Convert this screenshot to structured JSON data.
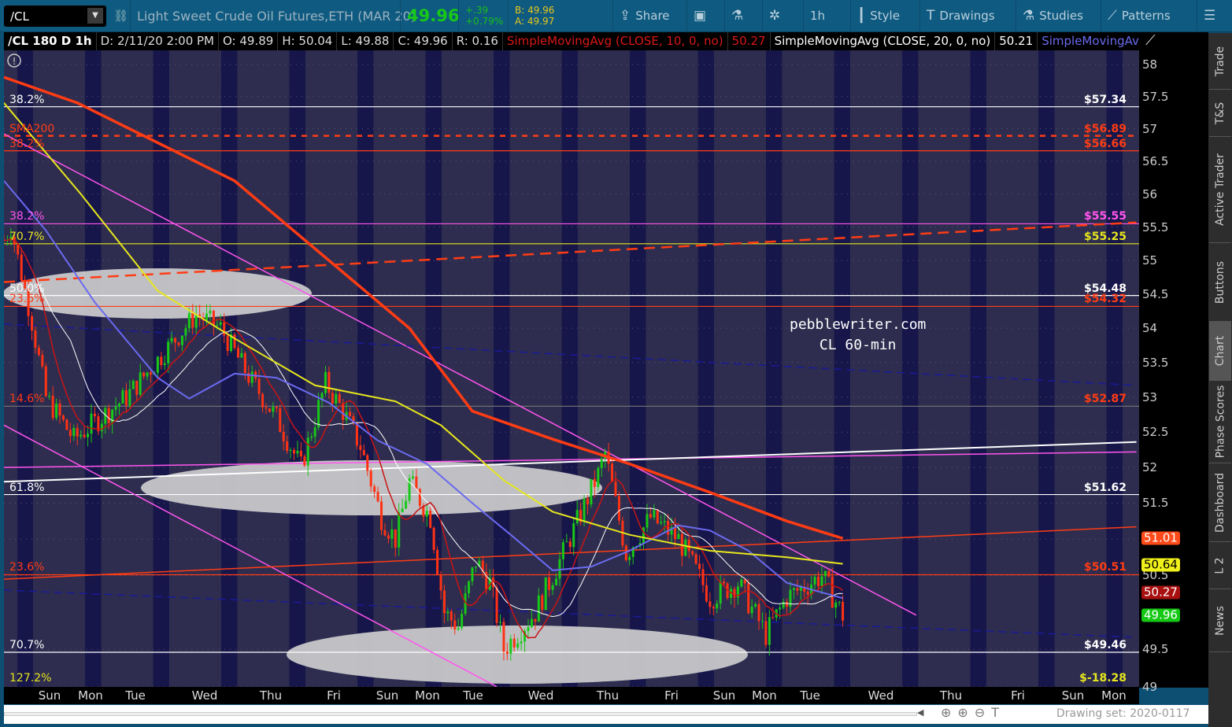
{
  "toolbar": {
    "symbol": "/CL",
    "description": "Light Sweet Crude Oil Futures,ETH (MAR 20)",
    "last": "49.96",
    "change": "+.39",
    "change_pct": "+0.79%",
    "bid": "B: 49.96",
    "ask": "A: 49.97",
    "buttons": [
      {
        "label": "Share",
        "icon": "share-icon"
      },
      {
        "label": "",
        "icon": "info-icon"
      },
      {
        "label": "",
        "icon": "flask-icon"
      },
      {
        "label": "",
        "icon": "gear-icon"
      },
      {
        "label": "1h",
        "icon": ""
      },
      {
        "label": "Style",
        "icon": "candle-icon"
      },
      {
        "label": "Drawings",
        "icon": "text-t-icon"
      },
      {
        "label": "Studies",
        "icon": "flask-icon"
      },
      {
        "label": "Patterns",
        "icon": "patterns-icon"
      },
      {
        "label": "",
        "icon": "menu-icon"
      }
    ]
  },
  "header": {
    "title": "/CL 180 D 1h",
    "date": "D: 2/11/20 2:00 PM",
    "open": "O: 49.89",
    "high": "H: 50.04",
    "low": "L: 49.88",
    "close": "C: 49.96",
    "range": "R: 0.16",
    "sma1": "SimpleMovingAvg (CLOSE, 10, 0, no)",
    "sma1_val": "50.27",
    "sma2": "SimpleMovingAvg (CLOSE, 20, 0, no)",
    "sma2_val": "50.21",
    "sma3": "SimpleMovingAvg ..."
  },
  "watermark": [
    "pebblewriter.com",
    "CL 60-min"
  ],
  "sidebar": [
    "Trade",
    "T&S",
    "Active Trader",
    "Buttons",
    "Chart",
    "Phase Scores",
    "Dashboard",
    "L 2",
    "News"
  ],
  "drawing_set": "Drawing set: 2020-0117",
  "colors": {
    "sma200": "#ff3c14",
    "sma100": "#e6e61e",
    "sma50": "#6a6af0",
    "sma10": "#c81414",
    "sma20": "#ffffff",
    "up": "#18c818",
    "down": "#ff3214",
    "bg": "#2e2d4f",
    "session": "#17164a"
  },
  "chart_data": {
    "type": "candlestick",
    "ylim": [
      48.9,
      58.4
    ],
    "scale": "log",
    "yticks": [
      "58",
      "57.5",
      "57",
      "56.5",
      "56",
      "55.5",
      "55",
      "54.5",
      "54",
      "53.5",
      "53",
      "52.5",
      "52",
      "51.5",
      "51",
      "50.5",
      "49.5",
      "49"
    ],
    "xticks": [
      "Sun",
      "Mon",
      "Tue",
      "Wed",
      "Thu",
      "Fri",
      "Sun",
      "Mon",
      "Tue",
      "Wed",
      "Thu",
      "Fri",
      "Sun",
      "Mon",
      "Tue",
      "Wed",
      "Thu",
      "Fri",
      "Sun",
      "Mon"
    ],
    "price_tags": [
      {
        "value": "51.01",
        "bg": "#ff4a1a",
        "fg": "#fff"
      },
      {
        "value": "50.64",
        "bg": "#f0f01a",
        "fg": "#000"
      },
      {
        "value": "50.27",
        "bg": "#a81010",
        "fg": "#fff"
      },
      {
        "value": "49.96",
        "bg": "#14c814",
        "fg": "#fff"
      }
    ],
    "levels": [
      {
        "price": 57.34,
        "color": "#ffffff",
        "left": "38.2%",
        "right": "$57.34"
      },
      {
        "price": 56.89,
        "color": "#ff3c14",
        "left": "SMA200",
        "right": "$56.89",
        "dashed": true
      },
      {
        "price": 56.66,
        "color": "#ff3c14",
        "left": "38.2%",
        "right": "$56.66"
      },
      {
        "price": 55.55,
        "color": "#ff55ee",
        "left": "38.2%",
        "right": "$55.55"
      },
      {
        "price": 55.25,
        "color": "#e6e61e",
        "left": "70.7%",
        "right": "$55.25"
      },
      {
        "price": 54.48,
        "color": "#ffffff",
        "left": "50.0%",
        "right": "$54.48"
      },
      {
        "price": 54.32,
        "color": "#ff3c14",
        "left": "23.6%",
        "right": "$54.32"
      },
      {
        "price": 52.87,
        "color": "#ff3c14",
        "left": "14.6%",
        "right": "$52.87",
        "line": "#777"
      },
      {
        "price": 51.62,
        "color": "#ffffff",
        "left": "61.8%",
        "right": "$51.62"
      },
      {
        "price": 50.51,
        "color": "#ff3c14",
        "left": "23.6%",
        "right": "$50.51",
        "right2color": "#ff55ee"
      },
      {
        "price": 49.46,
        "color": "#ffffff",
        "left": "70.7%",
        "right": "$49.46"
      },
      {
        "price": 49.0,
        "color": "#e6e61e",
        "left": "127.2%",
        "right": "$-18.28",
        "noline": true
      }
    ],
    "trendlines": [
      {
        "name": "magenta-trendline-upper",
        "color": "#ff55ee",
        "from": [
          0,
          56.92
        ],
        "to": [
          261,
          49.96
        ]
      },
      {
        "name": "magenta-trendline-lower",
        "color": "#ff55ee",
        "from": [
          0,
          52.6
        ],
        "to": [
          141,
          49.0
        ]
      },
      {
        "name": "magenta-trendline-flat",
        "color": "#ff55ee",
        "from": [
          0,
          52.0
        ],
        "to": [
          324,
          52.22
        ]
      },
      {
        "name": "white-trendline",
        "color": "#ffffff",
        "from": [
          0,
          51.8
        ],
        "to": [
          324,
          52.36
        ],
        "width": 2
      },
      {
        "name": "red-dashed-trendline",
        "color": "#ff3c14",
        "from": [
          0,
          54.68
        ],
        "to": [
          324,
          55.57
        ],
        "dash": "14 8",
        "width": 2.5
      },
      {
        "name": "red-thin-trendline",
        "color": "#ff3c14",
        "from": [
          0,
          50.45
        ],
        "to": [
          324,
          51.17
        ]
      },
      {
        "name": "navy-dashed-trendline",
        "color": "#1a1a9a",
        "from": [
          0,
          54.06
        ],
        "to": [
          324,
          53.17
        ],
        "dash": "10 6"
      },
      {
        "name": "navy-dashed-trendline-2",
        "color": "#1a1a9a",
        "from": [
          0,
          50.3
        ],
        "to": [
          324,
          49.66
        ],
        "dash": "10 6"
      }
    ],
    "sma200": [
      [
        0,
        57.8
      ],
      [
        21,
        57.4
      ],
      [
        66,
        56.2
      ],
      [
        93,
        55.0
      ],
      [
        116,
        54.0
      ],
      [
        134,
        52.8
      ],
      [
        157,
        52.4
      ],
      [
        179,
        52.05
      ],
      [
        202,
        51.65
      ],
      [
        224,
        51.25
      ],
      [
        240,
        51.01
      ]
    ],
    "sma100": [
      [
        0,
        57.4
      ],
      [
        22,
        56.0
      ],
      [
        44,
        54.55
      ],
      [
        66,
        53.85
      ],
      [
        89,
        53.17
      ],
      [
        112,
        52.94
      ],
      [
        125,
        52.6
      ],
      [
        143,
        51.82
      ],
      [
        157,
        51.38
      ],
      [
        179,
        51.06
      ],
      [
        202,
        50.84
      ],
      [
        224,
        50.75
      ],
      [
        240,
        50.66
      ]
    ],
    "sma50": [
      [
        0,
        56.2
      ],
      [
        12,
        55.45
      ],
      [
        26,
        54.38
      ],
      [
        44,
        53.28
      ],
      [
        53,
        52.98
      ],
      [
        66,
        53.34
      ],
      [
        78,
        53.28
      ],
      [
        93,
        52.92
      ],
      [
        107,
        52.38
      ],
      [
        121,
        52.05
      ],
      [
        134,
        51.5
      ],
      [
        145,
        51.06
      ],
      [
        157,
        50.57
      ],
      [
        168,
        50.62
      ],
      [
        179,
        50.84
      ],
      [
        193,
        51.19
      ],
      [
        202,
        51.12
      ],
      [
        213,
        50.84
      ],
      [
        224,
        50.4
      ],
      [
        240,
        50.19
      ]
    ],
    "close_path": [
      [
        0,
        55.3
      ],
      [
        2,
        55.5
      ],
      [
        8,
        54.1
      ],
      [
        12,
        53.0
      ],
      [
        20,
        52.4
      ],
      [
        35,
        53.0
      ],
      [
        55,
        54.2
      ],
      [
        62,
        54.0
      ],
      [
        70,
        53.3
      ],
      [
        78,
        52.7
      ],
      [
        85,
        52.0
      ],
      [
        92,
        53.2
      ],
      [
        97,
        52.8
      ],
      [
        102,
        52.3
      ],
      [
        108,
        51.3
      ],
      [
        112,
        51.0
      ],
      [
        116,
        51.8
      ],
      [
        122,
        51.3
      ],
      [
        126,
        50.0
      ],
      [
        130,
        49.8
      ],
      [
        135,
        50.7
      ],
      [
        139,
        50.4
      ],
      [
        143,
        49.5
      ],
      [
        152,
        50.0
      ],
      [
        160,
        50.8
      ],
      [
        170,
        51.9
      ],
      [
        172,
        52.2
      ],
      [
        178,
        50.8
      ],
      [
        185,
        51.3
      ],
      [
        193,
        51.0
      ],
      [
        202,
        50.2
      ],
      [
        210,
        50.4
      ],
      [
        218,
        49.7
      ],
      [
        224,
        50.2
      ],
      [
        234,
        50.5
      ],
      [
        240,
        49.96
      ]
    ]
  }
}
